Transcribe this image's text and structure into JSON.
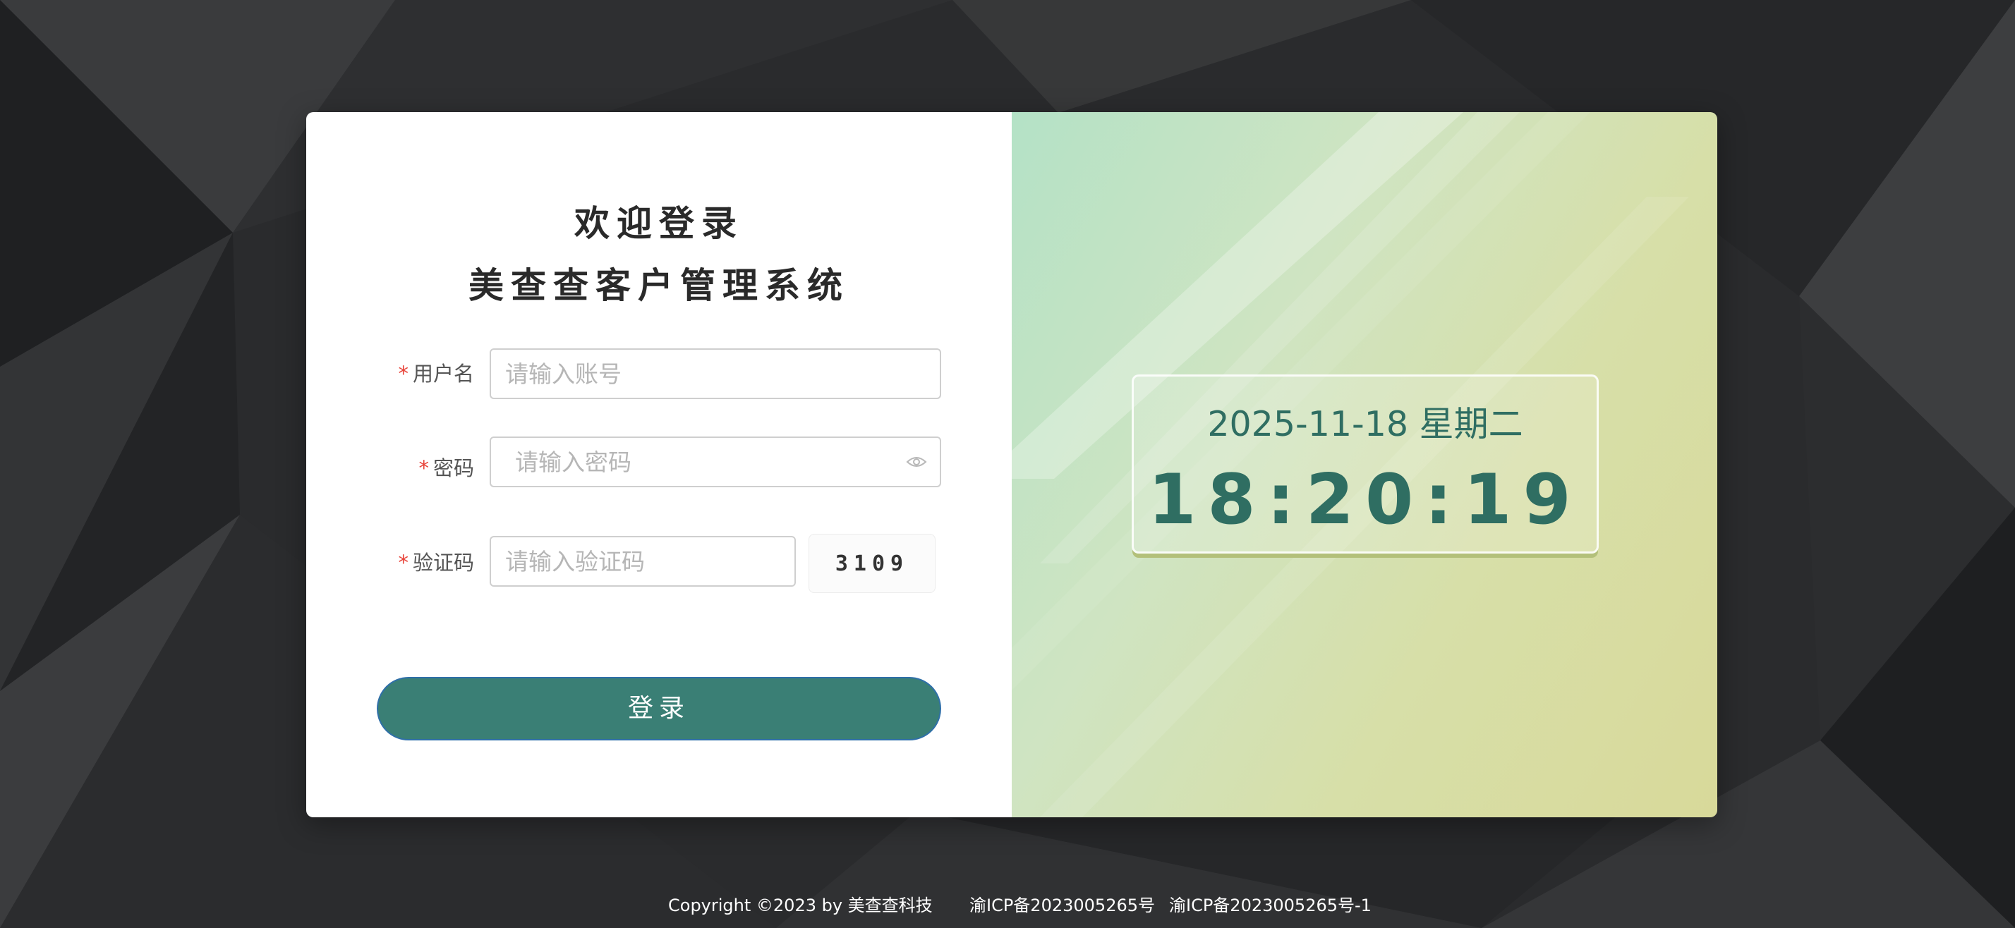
{
  "login": {
    "welcome_line1": "欢迎登录",
    "welcome_line2": "美查查客户管理系统",
    "username": {
      "label": "用户名",
      "required_mark": "*",
      "placeholder": "请输入账号",
      "value": ""
    },
    "password": {
      "label": "密码",
      "required_mark": "*",
      "placeholder": "请输入密码",
      "value": "",
      "toggle_icon": "eye-icon"
    },
    "captcha": {
      "label": "验证码",
      "required_mark": "*",
      "placeholder": "请输入验证码",
      "value": "",
      "code": "3109"
    },
    "submit_label": "登录"
  },
  "clock": {
    "date": "2025-11-18 星期二",
    "time": "18:20:19"
  },
  "footer": {
    "copyright": "Copyright ©2023 by 美查查科技",
    "icp1": "渝ICP备2023005265号",
    "icp2": "渝ICP备2023005265号-1"
  },
  "colors": {
    "accent": "#3a7f75",
    "clock_text": "#2f6e62",
    "required": "#e8443a",
    "background": "#2a2b2d"
  }
}
